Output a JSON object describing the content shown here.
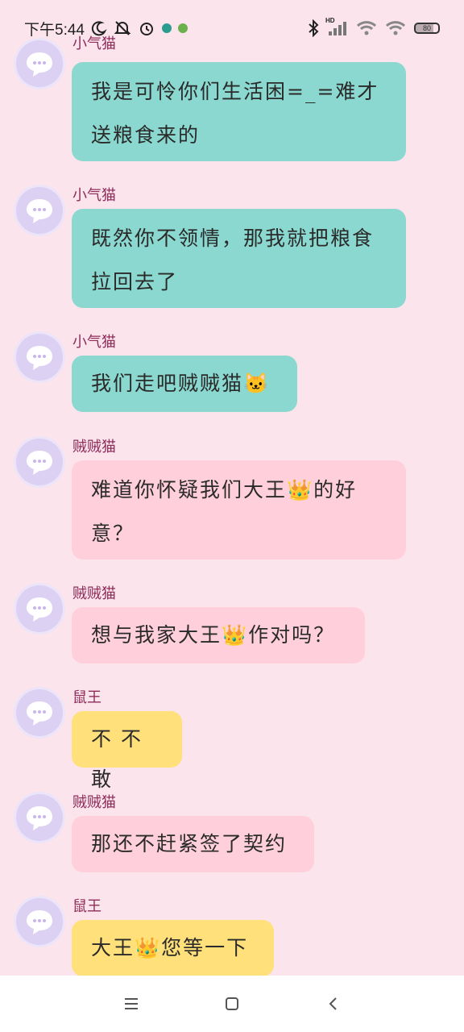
{
  "status": {
    "time": "下午5:44",
    "battery": "80",
    "battery_level": 0.8,
    "hd_label": "HD",
    "icons_left": [
      "moon-icon",
      "mute-bell-icon",
      "alarm-icon",
      "app-notification-icon",
      "app-notification-icon"
    ],
    "icons_right": [
      "bluetooth-icon",
      "cell-signal-icon",
      "wifi-icon",
      "wifi-icon",
      "battery-icon"
    ]
  },
  "messages": [
    {
      "sender": "小气猫",
      "text": "我是可怜你们生活困=_=难才送粮食来的",
      "lines": [
        "我是可怜你们生活困=_=难才",
        "送粮食来的"
      ],
      "color": "teal"
    },
    {
      "sender": "小气猫",
      "text": "既然你不领情，那我就把粮食拉回去了",
      "lines": [
        "既然你不领情，那我就把粮食",
        "拉回去了"
      ],
      "color": "teal"
    },
    {
      "sender": "小气猫",
      "text": "我们走吧贼贼猫🐱",
      "lines": [
        "我们走吧贼贼猫🐱"
      ],
      "color": "teal"
    },
    {
      "sender": "贼贼猫",
      "text": "难道你怀疑我们大王👑的好意？",
      "lines": [
        "难道你怀疑我们大王👑的好",
        "意？"
      ],
      "color": "pink"
    },
    {
      "sender": "贼贼猫",
      "text": "想与我家大王👑作对吗？",
      "lines": [
        "想与我家大王👑作对吗？"
      ],
      "color": "pink"
    },
    {
      "sender": "鼠王",
      "text": "不 不敢",
      "lines": [
        "不 不敢"
      ],
      "color": "yellow"
    },
    {
      "sender": "贼贼猫",
      "text": "那还不赶紧签了契约",
      "lines": [
        "那还不赶紧签了契约"
      ],
      "color": "pink"
    },
    {
      "sender": "鼠王",
      "text": "大王👑您等一下",
      "lines": [
        "大王👑您等一下"
      ],
      "color": "yellow"
    }
  ],
  "colors": {
    "background": "#fbe4ec",
    "teal_bubble": "#8ad8cf",
    "pink_bubble": "#ffcfdc",
    "yellow_bubble": "#ffe07a",
    "sender_name": "#8e2c5a",
    "avatar": "#dcd0f3"
  },
  "navbar": {
    "buttons": [
      "menu-icon",
      "home-square-icon",
      "back-chevron-icon"
    ]
  }
}
